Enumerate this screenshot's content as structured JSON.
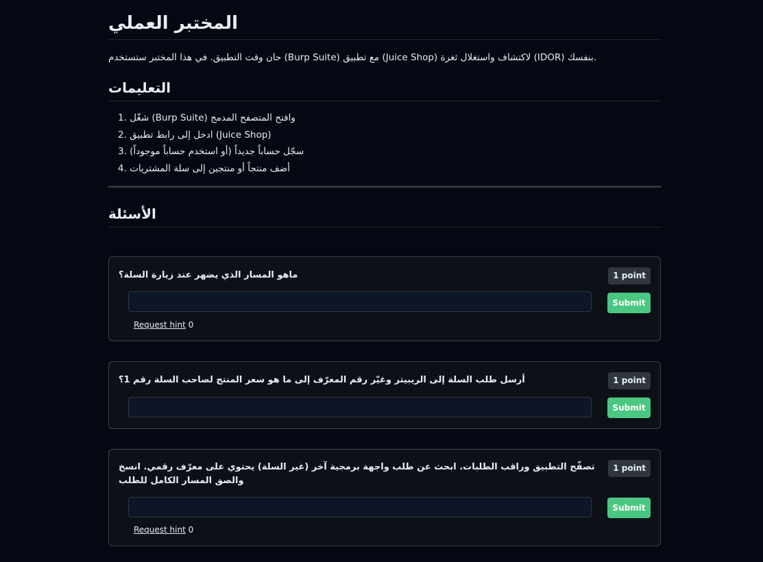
{
  "page": {
    "title": "المختبر العملي",
    "intro": "حان وقت التطبيق. في هذا المختبر ستستخدم (Burp Suite) مع تطبيق (Juice Shop) لاكتشاف واستغلال ثغرة (IDOR) بنفسك."
  },
  "instructions": {
    "title": "التعليمات",
    "items": [
      "1. شغّل (Burp Suite) وافتح المتصفح المدمج",
      "2. ادخل إلى رابط تطبيق (Juice Shop)",
      "3. سجّل حساباً جديداً (أو استخدم حساباً موجوداً)",
      "4. أضف منتجاً أو منتجين إلى سلة المشتريات"
    ]
  },
  "questions": {
    "title": "الأسئلة",
    "items": [
      {
        "text": "ماهو المسار الذي يضهر عند زيارة السلة؟",
        "points": "1 point",
        "answer_value": "",
        "submit_label": "Submit",
        "hint_label": "Request hint",
        "hint_count": "0"
      },
      {
        "text": "أرسل طلب السلة إلى الريبيتر وغيّر رقم المعرّف إلى ما هو سعر المنتج لصاحب السلة رقم 1؟",
        "points": "1 point",
        "answer_value": "",
        "submit_label": "Submit"
      },
      {
        "text": "تصفّح التطبيق وراقب الطلبات. ابحث عن طلب واجهة برمجية آخر (غير السلة) يحتوي على معرّف رقمي. انسخ والصق المسار الكامل للطلب",
        "points": "1 point",
        "answer_value": "",
        "submit_label": "Submit",
        "hint_label": "Request hint",
        "hint_count": "0"
      }
    ]
  },
  "colors": {
    "background": "#030812",
    "card_border": "#3b4048",
    "submit": "#4ac780",
    "badge": "#30363d"
  }
}
